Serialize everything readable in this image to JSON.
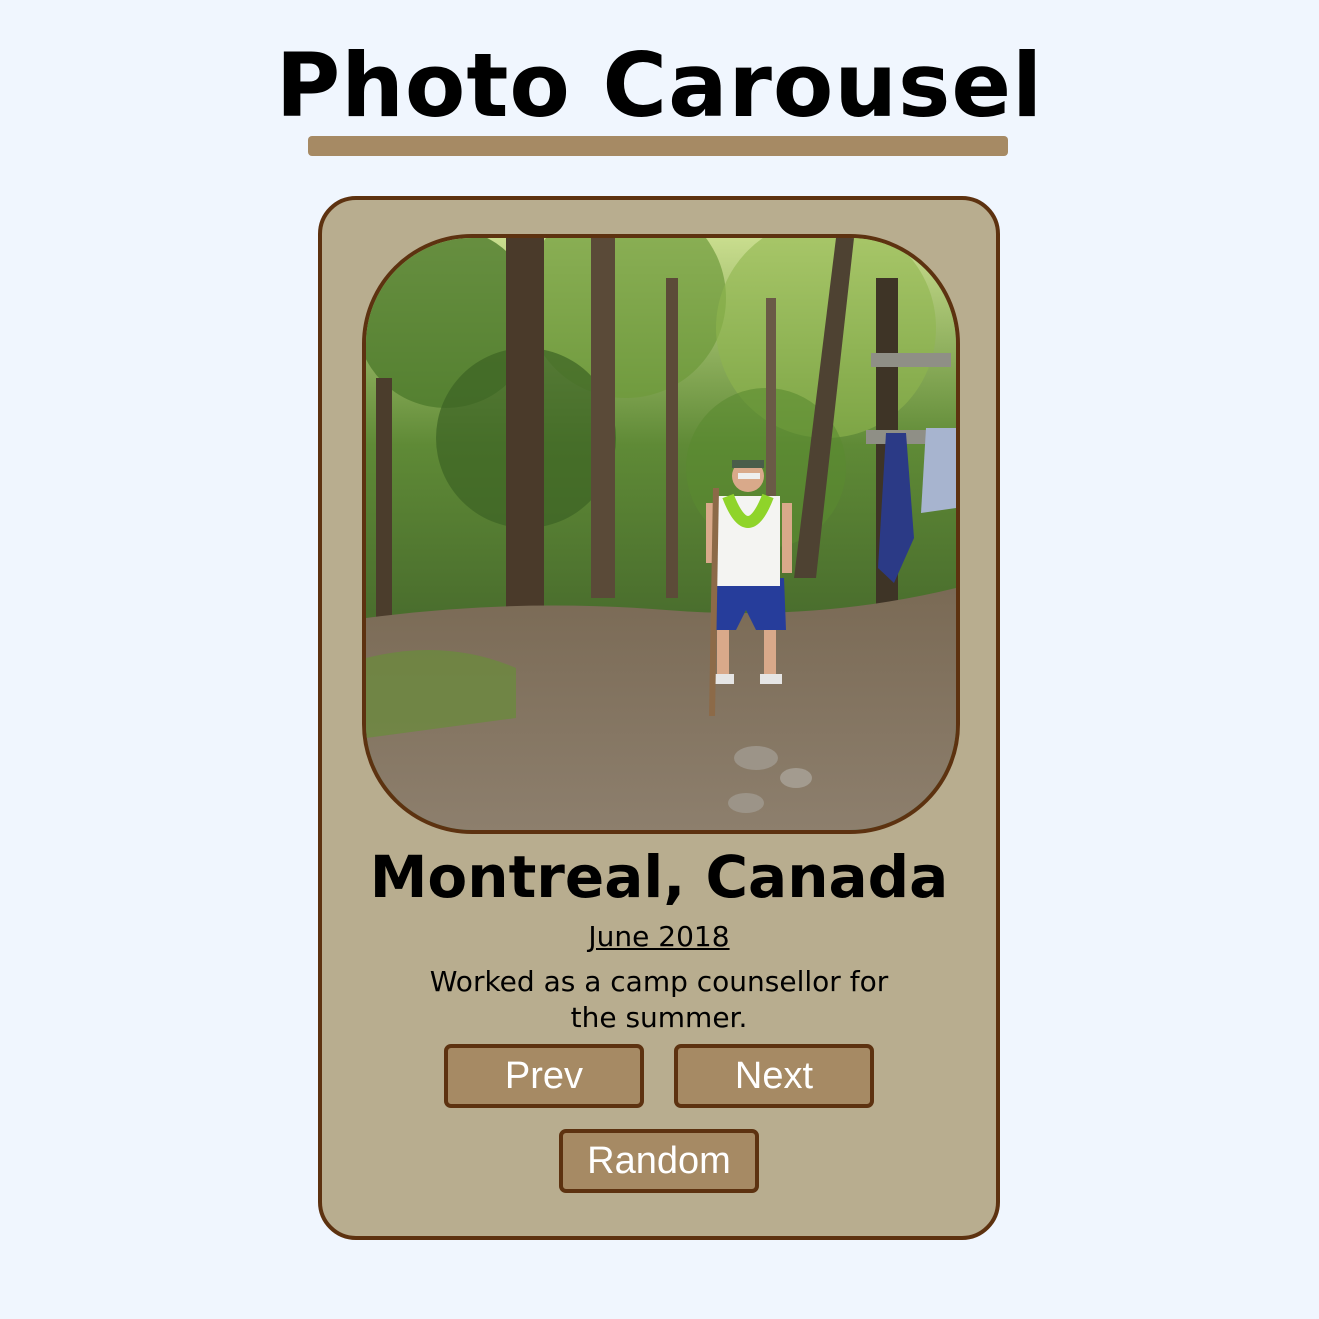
{
  "header": {
    "title": "Photo Carousel"
  },
  "colors": {
    "page_background": "#f0f6fe",
    "accent": "#a68a64",
    "card_background": "#b8ad8f",
    "border": "#5d3210"
  },
  "slide": {
    "photo_subject": "person-standing-in-forest-photo",
    "location": "Montreal, Canada",
    "date": "June 2018",
    "description": "Worked as a camp counsellor for the summer."
  },
  "controls": {
    "prev_label": "Prev",
    "next_label": "Next",
    "random_label": "Random"
  }
}
